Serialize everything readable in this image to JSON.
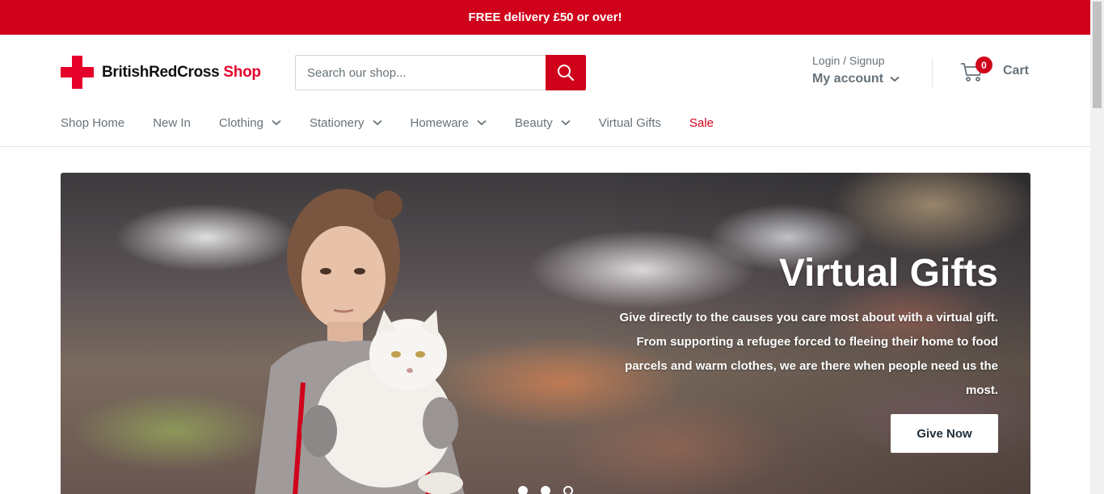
{
  "announcement": {
    "text": "FREE delivery £50 or over!"
  },
  "header": {
    "brand": {
      "name": "BritishRedCross",
      "suffix": "Shop"
    },
    "search": {
      "placeholder": "Search our shop..."
    },
    "account": {
      "login_signup": "Login / Signup",
      "my_account": "My account"
    },
    "cart": {
      "count": "0",
      "label": "Cart"
    }
  },
  "nav": {
    "items": [
      {
        "label": "Shop Home",
        "dropdown": false
      },
      {
        "label": "New In",
        "dropdown": false
      },
      {
        "label": "Clothing",
        "dropdown": true
      },
      {
        "label": "Stationery",
        "dropdown": true
      },
      {
        "label": "Homeware",
        "dropdown": true
      },
      {
        "label": "Beauty",
        "dropdown": true
      },
      {
        "label": "Virtual Gifts",
        "dropdown": false
      },
      {
        "label": "Sale",
        "dropdown": false,
        "highlight": "#d0021b"
      }
    ]
  },
  "hero": {
    "title": "Virtual Gifts",
    "body": "Give directly to the causes you care most about with a virtual gift. From supporting a refugee forced to fleeing their home to food parcels and warm clothes, we are there when people need us the most.",
    "cta": "Give Now",
    "slides": 3,
    "active_slide": 1
  },
  "colors": {
    "brand_red": "#d0021b",
    "logo_red": "#e5002a",
    "text_grey": "#677279"
  }
}
